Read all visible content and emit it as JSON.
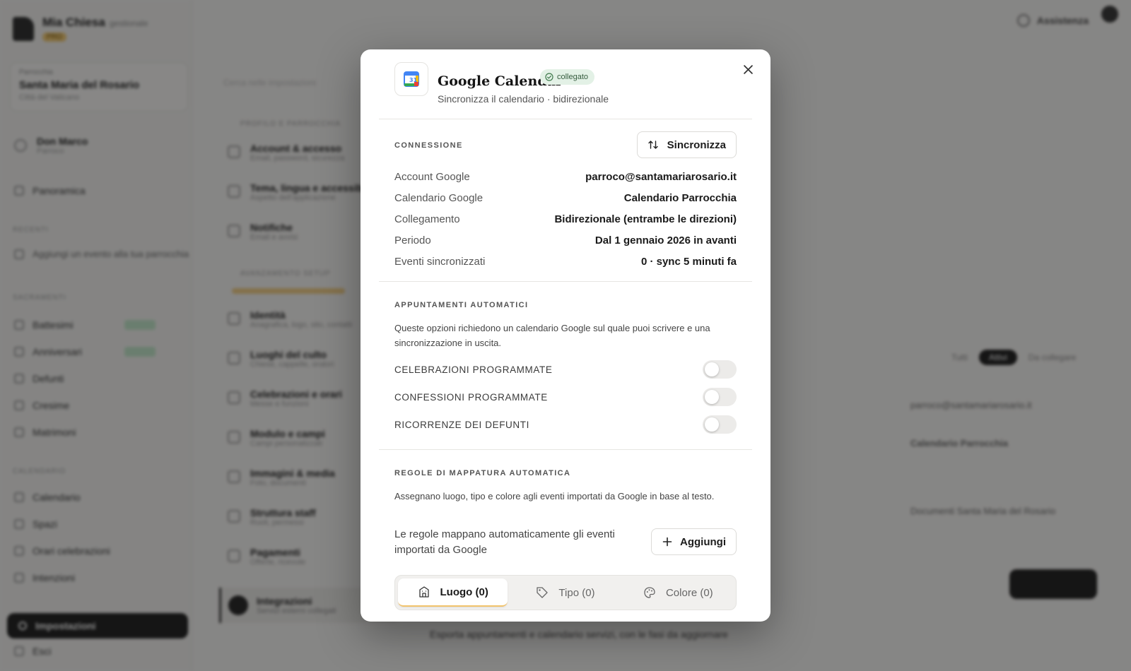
{
  "background": {
    "brand": {
      "name": "Mia Chiesa",
      "sub": "gestionale",
      "badge": "PRO"
    },
    "parish": {
      "label": "Parrocchia",
      "name": "Santa Maria del Rosario",
      "city": "Città del Vaticano"
    },
    "user": {
      "name": "Don Marco",
      "role": "Parroco"
    },
    "nav": {
      "home": "Panoramica",
      "section_recent": "RECENTI",
      "recent_item": "Aggiungi un evento alla tua parrocchia",
      "section_sacraments": "SACRAMENTI",
      "items": [
        "Battesimi",
        "Anniversari",
        "Defunti",
        "Cresime",
        "Matrimoni"
      ],
      "section_calendar": "CALENDARIO",
      "calendar_items": [
        "Calendario",
        "Spazi",
        "Orari celebrazioni",
        "Intenzioni"
      ],
      "active": "Impostazioni",
      "bottom": "Esci"
    },
    "middle": {
      "search": "Cerca nelle impostazioni",
      "section1": "PROFILO E PARROCCHIA",
      "rows": [
        {
          "title": "Account & accesso",
          "sub": "Email, password, sicurezza"
        },
        {
          "title": "Tema, lingua e accessibilità",
          "sub": "Aspetto dell'applicazione"
        },
        {
          "title": "Notifiche",
          "sub": "Email e avvisi"
        }
      ],
      "section2": "AVANZAMENTO SETUP",
      "rows2": [
        {
          "title": "Identità",
          "sub": "Anagrafica, logo, sito, contatti"
        },
        {
          "title": "Luoghi del culto",
          "sub": "Chiese, cappelle, oratori"
        },
        {
          "title": "Celebrazioni e orari",
          "sub": "Messe e funzioni"
        },
        {
          "title": "Modulo e campi",
          "sub": "Campi personalizzati"
        },
        {
          "title": "Immagini & media",
          "sub": "Foto, documenti"
        },
        {
          "title": "Struttura staff",
          "sub": "Ruoli, permessi"
        },
        {
          "title": "Pagamenti",
          "sub": "Offerte, ricevute"
        }
      ],
      "active_title": "Integrazioni",
      "active_sub": "Servizi esterni collegati"
    },
    "top_right": {
      "label": "Assistenza"
    },
    "segments": [
      "Tutti",
      "Attivi",
      "Da collegare"
    ],
    "right_lines": [
      "parroco@santamariarosario.it",
      "Calendario Parrocchia",
      "Documenti Santa Maria del Rosario"
    ],
    "bottom_text": "Esporta appuntamenti e calendario servizi, con le fasi da aggiornare"
  },
  "modal": {
    "title": "Google Calendar",
    "badge": "collegato",
    "subtitle": "Sincronizza il calendario · bidirezionale",
    "connection": {
      "title": "CONNESSIONE",
      "sync_button": "Sincronizza",
      "rows": [
        {
          "key": "Account Google",
          "value": "parroco@santamariarosario.it"
        },
        {
          "key": "Calendario Google",
          "value": "Calendario Parrocchia"
        },
        {
          "key": "Collegamento",
          "value": "Bidirezionale (entrambe le direzioni)"
        },
        {
          "key": "Periodo",
          "value": "Dal 1 gennaio 2026 in avanti"
        },
        {
          "key": "Eventi sincronizzati",
          "value": "0 · sync 5 minuti fa"
        }
      ]
    },
    "auto": {
      "title": "APPUNTAMENTI AUTOMATICI",
      "description": "Queste opzioni richiedono un calendario Google sul quale puoi scrivere e una sincronizzazione in uscita.",
      "toggles": [
        {
          "label": "CELEBRAZIONI PROGRAMMATE",
          "on": false
        },
        {
          "label": "CONFESSIONI PROGRAMMATE",
          "on": false
        },
        {
          "label": "RICORRENZE DEI DEFUNTI",
          "on": false
        }
      ]
    },
    "rules": {
      "title": "REGOLE DI MAPPATURA AUTOMATICA",
      "description": "Assegnano luogo, tipo e colore agli eventi importati da Google in base al testo.",
      "note": "Le regole mappano automaticamente gli eventi importati da Google",
      "add_button": "Aggiungi",
      "tabs": [
        {
          "label": "Luogo (0)",
          "icon": "building-icon",
          "active": true
        },
        {
          "label": "Tipo (0)",
          "icon": "tag-icon",
          "active": false
        },
        {
          "label": "Colore (0)",
          "icon": "palette-icon",
          "active": false
        }
      ]
    }
  },
  "colors": {
    "accent": "#f1c36b",
    "badge_bg": "#e3f1e6",
    "badge_text": "#355c3e",
    "overlay": "#0f0f0f"
  }
}
